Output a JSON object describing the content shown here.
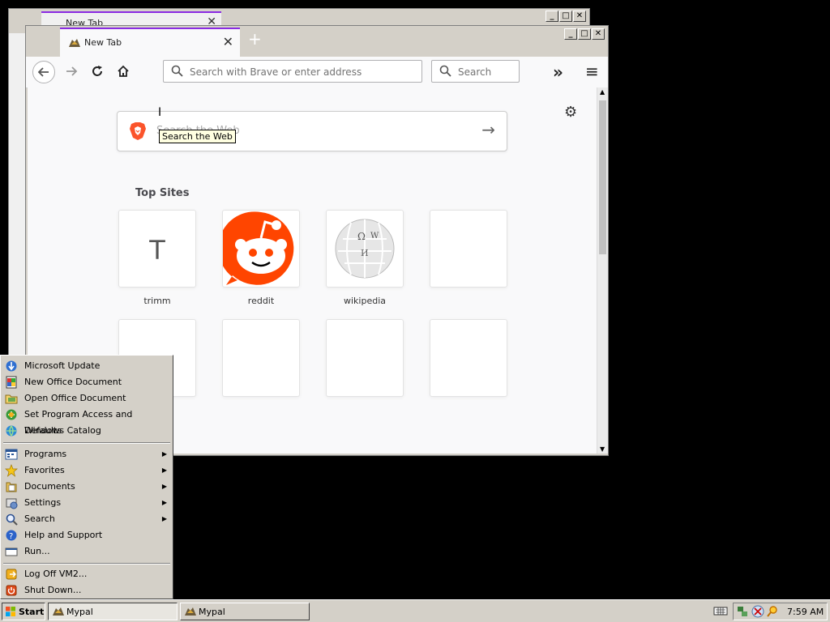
{
  "background_window": {
    "tab_title": "New Tab"
  },
  "browser": {
    "tab_title": "New Tab",
    "new_tab_symbol": "+",
    "urlbar_placeholder": "Search with Brave or enter address",
    "searchbar_placeholder": "Search",
    "overflow_symbol": "»",
    "menu_symbol": "≡",
    "websearch_placeholder": "Search the Web",
    "tooltip": "Search the Web",
    "top_sites_title": "Top Sites",
    "top_sites": [
      {
        "label": "trimm",
        "initial": "T"
      },
      {
        "label": "reddit"
      },
      {
        "label": "wikipedia"
      }
    ],
    "accent": "#8a2be2"
  },
  "start_menu": {
    "top_items": [
      {
        "label": "Microsoft Update",
        "icon": "update-icon"
      },
      {
        "label": "New Office Document",
        "icon": "new-doc-icon"
      },
      {
        "label": "Open Office Document",
        "icon": "open-doc-icon"
      },
      {
        "label": "Set Program Access and Defaults",
        "icon": "program-defaults-icon"
      },
      {
        "label": "Windows Catalog",
        "icon": "catalog-icon"
      }
    ],
    "main_items": [
      {
        "label": "Programs",
        "icon": "programs-icon",
        "submenu": true
      },
      {
        "label": "Favorites",
        "icon": "favorites-icon",
        "submenu": true
      },
      {
        "label": "Documents",
        "icon": "documents-icon",
        "submenu": true
      },
      {
        "label": "Settings",
        "icon": "settings-icon",
        "submenu": true
      },
      {
        "label": "Search",
        "icon": "search-icon",
        "submenu": true
      },
      {
        "label": "Help and Support",
        "icon": "help-icon",
        "submenu": false
      },
      {
        "label": "Run...",
        "icon": "run-icon",
        "submenu": false
      }
    ],
    "bottom_items": [
      {
        "label": "Log Off VM2...",
        "icon": "logoff-icon"
      },
      {
        "label": "Shut Down...",
        "icon": "shutdown-icon"
      }
    ]
  },
  "taskbar": {
    "start_label": "Start",
    "tasks": [
      {
        "label": "Mypal",
        "active": true
      },
      {
        "label": "Mypal",
        "active": false
      }
    ],
    "clock": "7:59 AM"
  }
}
